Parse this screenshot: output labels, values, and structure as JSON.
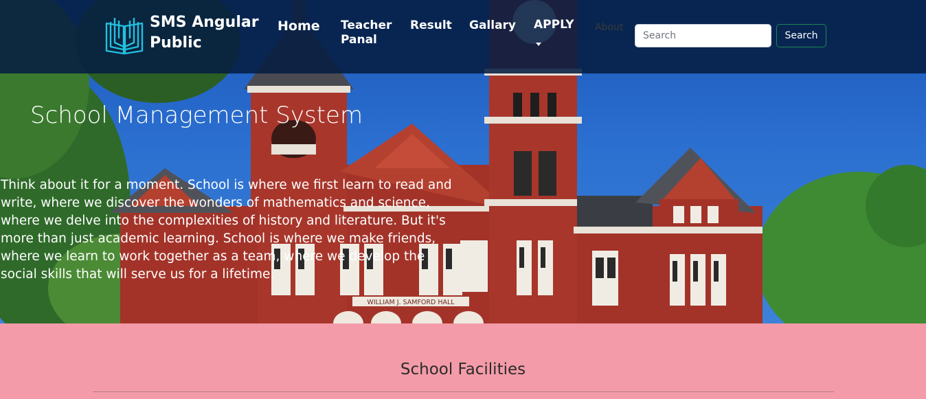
{
  "brand": {
    "name": "SMS Angular Public",
    "logo_icon": "open-book-icon"
  },
  "nav": {
    "home": "Home",
    "teacher_panel": "Teacher Panal",
    "result": "Result",
    "gallery": "Gallary",
    "apply": "APPLY",
    "about": "About"
  },
  "search": {
    "placeholder": "Search",
    "button_label": "Search"
  },
  "hero": {
    "title": "School Management System",
    "text": "Think about it for a moment. School is where we first learn to read and write, where we discover the wonders of mathematics and science, where we delve into the complexities of history and literature. But it's more than just academic learning. School is where we make friends, where we learn to work together as a team, where we develop the social skills that will serve us for a lifetime.",
    "building_sign": "WILLIAM J. SAMFORD HALL"
  },
  "facilities": {
    "title": "School Facilities"
  },
  "colors": {
    "navbar": "#061e42",
    "section_bg": "#f49ba9",
    "search_border": "#198754",
    "brick": "#a8362b"
  }
}
